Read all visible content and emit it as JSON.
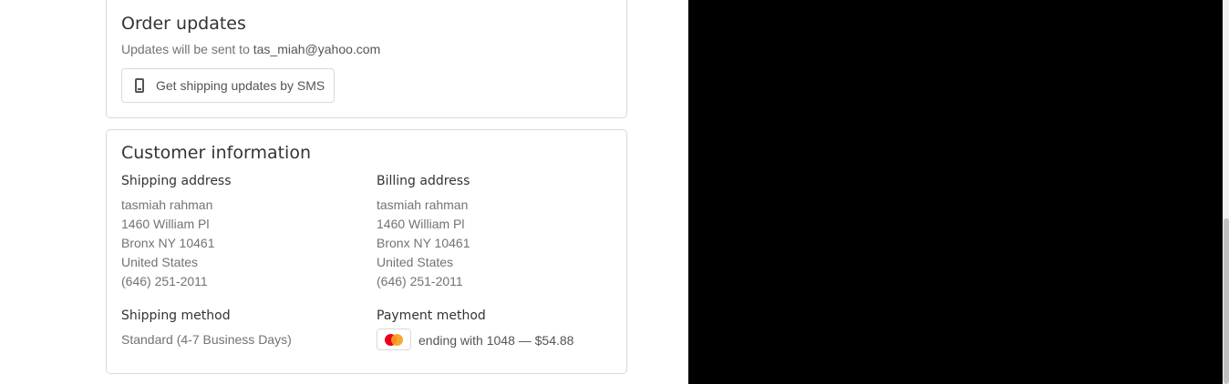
{
  "order_updates": {
    "title": "Order updates",
    "text_prefix": "Updates will be sent to ",
    "email": "tas_miah@yahoo.com",
    "sms_button_label": "Get shipping updates by SMS"
  },
  "customer_info": {
    "title": "Customer information",
    "shipping_address": {
      "heading": "Shipping address",
      "lines": [
        "tasmiah rahman",
        "1460 William Pl",
        "Bronx NY 10461",
        "United States",
        "(646) 251-2011"
      ]
    },
    "billing_address": {
      "heading": "Billing address",
      "lines": [
        "tasmiah rahman",
        "1460 William Pl",
        "Bronx NY 10461",
        "United States",
        "(646) 251-2011"
      ]
    },
    "shipping_method": {
      "heading": "Shipping method",
      "value": "Standard (4-7 Business Days)"
    },
    "payment_method": {
      "heading": "Payment method",
      "card_icon": "mastercard-icon",
      "value": "ending with 1048 — $54.88"
    }
  },
  "colors": {
    "right_pane": "#000000",
    "border": "#d9d9d9",
    "text_muted": "#737373"
  }
}
